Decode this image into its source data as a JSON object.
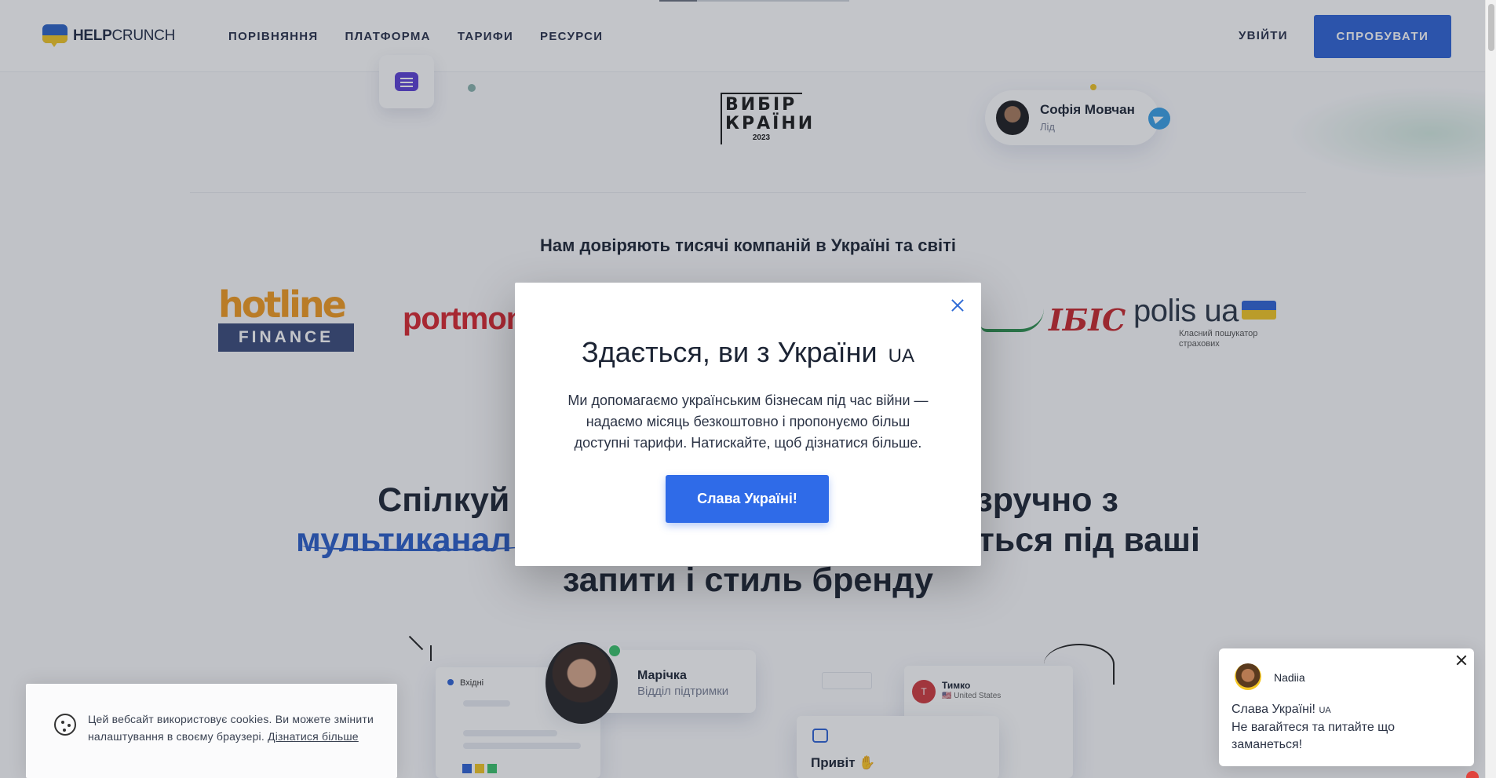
{
  "header": {
    "logo_bold": "HELP",
    "logo_light": "CRUNCH",
    "nav": [
      "ПОРІВНЯННЯ",
      "ПЛАТФОРМА",
      "ТАРИФИ",
      "РЕСУРСИ"
    ],
    "login_label": "УВІЙТИ",
    "try_label": "СПРОБУВАТИ"
  },
  "hero": {
    "award_line1": "ВИБІР",
    "award_line2": "КРАЇНИ",
    "award_year": "2023",
    "person_name": "Софія Мовчан",
    "person_role": "Лід"
  },
  "trust": {
    "title": "Нам довіряють тисячі компаній в Україні та світі",
    "logos": {
      "hotline_top": "hotline",
      "hotline_bottom": "FINANCE",
      "portmone": "portmon",
      "ibis": "IБIC",
      "polis": "polis ua",
      "polis_sub": "Класний пошукатор страхових"
    }
  },
  "headline": {
    "line1_a": "Спілкуй",
    "line1_b": "зручно з",
    "line2_a": "мультиканал",
    "line2_b": "ться під ваші",
    "line3": "запити і стиль бренду"
  },
  "mockup": {
    "inbox_label": "Вхідні",
    "agent_name": "Марічка",
    "agent_role": "Відділ підтримки",
    "contact_initial": "T",
    "contact_name": "Тимко",
    "contact_country": "🇺🇸 United States",
    "hello_text": "Привіт ✋"
  },
  "modal": {
    "title": "Здається, ви з України",
    "country_code": "UA",
    "body": "Ми допомагаємо українським бізнесам під час війни — надаємо місяць безкоштовно і пропонуємо більш доступні тарифи. Натискайте, щоб дізнатися більше.",
    "button": "Слава Україні!"
  },
  "cookie": {
    "text": "Цей вебсайт використовує cookies. Ви можете змінити налаштування в своєму браузері.",
    "link": "Дізнатися більше"
  },
  "chat": {
    "agent": "Nadiia",
    "greeting": "Слава Україні!",
    "country_code": "UA",
    "message": "Не вагайтеся та питайте що заманеться!"
  },
  "colors": {
    "brand_blue": "#2f63d6",
    "button_blue": "#2f6be8",
    "ukraine_yellow": "#f3c623"
  }
}
